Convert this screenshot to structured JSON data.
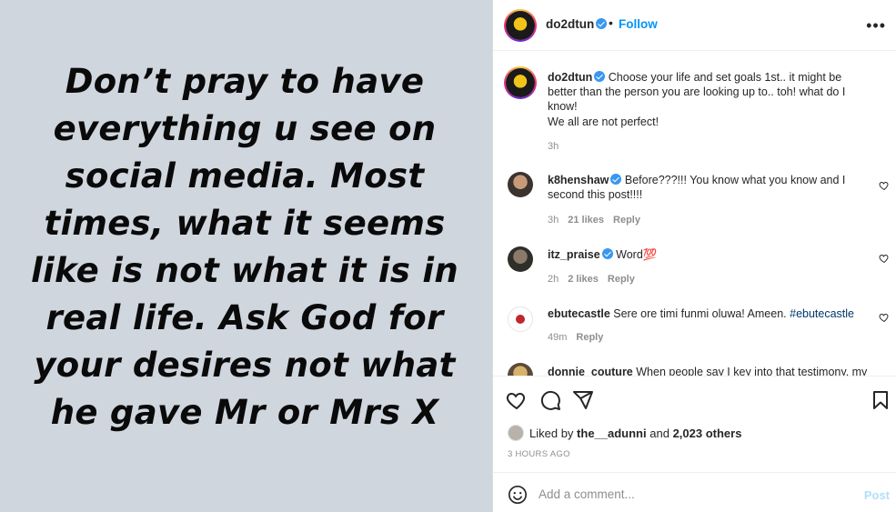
{
  "media": {
    "quote": "Don’t pray to have everything u see on social media. Most times, what it seems like is not what it is in real life. Ask God for your desires not what he gave Mr or Mrs X"
  },
  "header": {
    "username": "do2dtun",
    "separator": "•",
    "follow_label": "Follow",
    "more_icon": "more-horizontal-icon"
  },
  "caption": {
    "username": "do2dtun",
    "text": "Choose your life and set goals 1st.. it might be better than the person you are looking up to.. toh! what do I know!",
    "text2": "We all are not perfect!",
    "time": "3h"
  },
  "comments": [
    {
      "username": "k8henshaw",
      "text": "Before???!!! You know what you know and I second this post!!!!",
      "time": "3h",
      "likes": "21 likes",
      "reply": "Reply"
    },
    {
      "username": "itz_praise",
      "text": "Word💯",
      "time": "2h",
      "likes": "2 likes",
      "reply": "Reply"
    },
    {
      "username": "ebutecastle",
      "text": "Sere ore timi funmi oluwa! Ameen.",
      "hashtag": "#ebutecastle",
      "time": "49m",
      "reply": "Reply"
    },
    {
      "username": "donnie_couture",
      "text": "When people say I key into that testimony, my"
    }
  ],
  "actions": {
    "like_icon": "heart-icon",
    "comment_icon": "comment-icon",
    "share_icon": "send-icon",
    "save_icon": "bookmark-icon"
  },
  "likes": {
    "prefix": "Liked by",
    "user": "the__adunni",
    "and": "and",
    "others": "2,023 others"
  },
  "timestamp": "3 HOURS AGO",
  "add_comment": {
    "placeholder": "Add a comment...",
    "post_label": "Post"
  },
  "colors": {
    "media_bg": "#d0d6de",
    "follow": "#0095f6",
    "post_disabled": "#b2dffc",
    "verified": "#3897f0"
  }
}
